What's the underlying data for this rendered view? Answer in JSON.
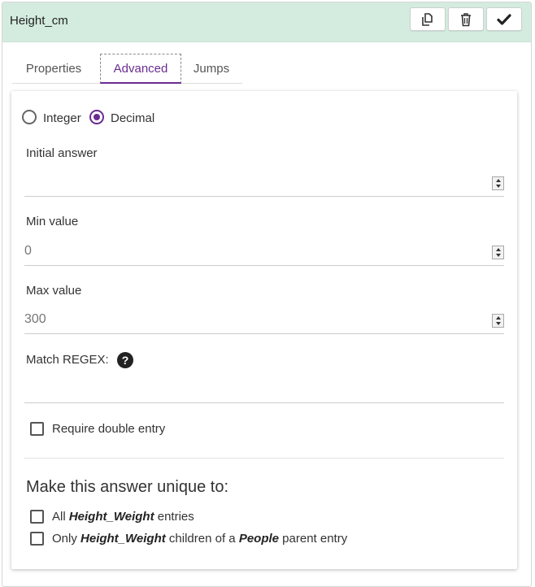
{
  "header": {
    "title": "Height_cm",
    "bg_color": "#d4ecdf"
  },
  "tabs": [
    {
      "label": "Properties",
      "active": false
    },
    {
      "label": "Advanced",
      "active": true
    },
    {
      "label": "Jumps",
      "active": false
    }
  ],
  "accent_color": "#6a2c91",
  "number_type": {
    "options": [
      {
        "label": "Integer",
        "selected": false
      },
      {
        "label": "Decimal",
        "selected": true
      }
    ]
  },
  "fields": {
    "initial_answer": {
      "label": "Initial answer",
      "value": ""
    },
    "min_value": {
      "label": "Min value",
      "value": "0"
    },
    "max_value": {
      "label": "Max value",
      "value": "300"
    },
    "match_regex": {
      "label": "Match REGEX:",
      "value": "",
      "help_icon": "question-circle-icon",
      "help_glyph": "?"
    }
  },
  "require_double_entry": {
    "label": "Require double entry",
    "checked": false
  },
  "unique": {
    "title": "Make this answer unique to:",
    "options": [
      {
        "prefix": "All",
        "entity": "Height_Weight",
        "suffix": "entries",
        "checked": false
      },
      {
        "prefix": "Only",
        "entity": "Height_Weight",
        "middle": "children of a",
        "parent": "People",
        "suffix": "parent entry",
        "checked": false
      }
    ]
  },
  "icons": {
    "copy": "copy-icon",
    "delete": "trash-icon",
    "confirm": "check-icon"
  }
}
